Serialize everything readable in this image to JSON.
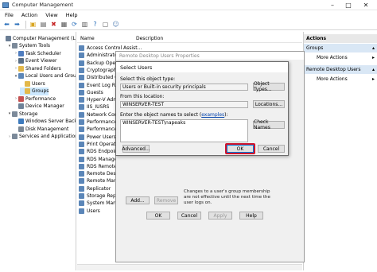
{
  "window": {
    "title": "Computer Management"
  },
  "menu": [
    "File",
    "Action",
    "View",
    "Help"
  ],
  "tree": [
    {
      "label": "Computer Management (Local",
      "level": 0,
      "exp": "",
      "icon": "computer",
      "color": "#6a7d94"
    },
    {
      "label": "System Tools",
      "level": 1,
      "exp": "▾",
      "icon": "tools",
      "color": "#7c8a9a"
    },
    {
      "label": "Task Scheduler",
      "level": 2,
      "exp": "›",
      "icon": "task",
      "color": "#4f7dbf"
    },
    {
      "label": "Event Viewer",
      "level": 2,
      "exp": "›",
      "icon": "event",
      "color": "#5a6f86"
    },
    {
      "label": "Shared Folders",
      "level": 2,
      "exp": "›",
      "icon": "folder",
      "color": "#e3b84a"
    },
    {
      "label": "Local Users and Groups",
      "level": 2,
      "exp": "▾",
      "icon": "users",
      "color": "#5b86b8"
    },
    {
      "label": "Users",
      "level": 3,
      "exp": "",
      "icon": "folder",
      "color": "#e3b84a"
    },
    {
      "label": "Groups",
      "level": 3,
      "exp": "",
      "icon": "folder",
      "color": "#e3b84a",
      "selected": true
    },
    {
      "label": "Performance",
      "level": 2,
      "exp": "›",
      "icon": "perf",
      "color": "#c45151"
    },
    {
      "label": "Device Manager",
      "level": 2,
      "exp": "",
      "icon": "device",
      "color": "#6e8298"
    },
    {
      "label": "Storage",
      "level": 1,
      "exp": "▾",
      "icon": "storage",
      "color": "#7c8a9a"
    },
    {
      "label": "Windows Server Backup",
      "level": 2,
      "exp": "",
      "icon": "backup",
      "color": "#3e7bbd"
    },
    {
      "label": "Disk Management",
      "level": 2,
      "exp": "",
      "icon": "disk",
      "color": "#7b8794"
    },
    {
      "label": "Services and Applications",
      "level": 1,
      "exp": "›",
      "icon": "services",
      "color": "#7c8a9a"
    }
  ],
  "columns": {
    "name": "Name",
    "description": "Description"
  },
  "groups": [
    "Access Control Assist...",
    "Administrators",
    "Backup Operators",
    "Cryptographic Ope...",
    "Distributed COM Users",
    "Event Log Readers",
    "Guests",
    "Hyper-V Administr...",
    "IIS_IUSRS",
    "Network Configurat...",
    "Performance Log Users",
    "Performance Monitor...",
    "Power Users",
    "Print Operators",
    "RDS Endpoint Servers",
    "RDS Management Se...",
    "RDS Remote Access...",
    "Remote Desktop Users",
    "Remote Management...",
    "Replicator",
    "Storage Replica Admi...",
    "System Managed Acc...",
    "Users"
  ],
  "actions": {
    "header": "Actions",
    "section1": "Groups",
    "more1": "More Actions",
    "section2": "Remote Desktop Users",
    "more2": "More Actions"
  },
  "backdialog": {
    "title": "Remote Desktop Users Properties",
    "add": "Add...",
    "remove": "Remove",
    "note": "Changes to a user's group membership are not effective until the next time the user logs on.",
    "ok": "OK",
    "cancel": "Cancel",
    "apply": "Apply",
    "help": "Help"
  },
  "dialog": {
    "title": "Select Users",
    "object_type_label": "Select this object type:",
    "object_type_value": "Users or Built-in security principals",
    "object_types_button": "Object Types...",
    "location_label": "From this location:",
    "location_value": "WINSERVER-TEST",
    "locations_button": "Locations...",
    "names_label_pre": "Enter the object names to select (",
    "names_label_link": "examples",
    "names_label_post": "):",
    "names_value": "WINSERVER-TEST\\napeaks",
    "check_names_button": "Check Names",
    "advanced_button": "Advanced...",
    "ok_button": "OK",
    "cancel_button": "Cancel"
  },
  "colors": {
    "highlight": "#d0142c",
    "selection": "#cce8ff"
  }
}
